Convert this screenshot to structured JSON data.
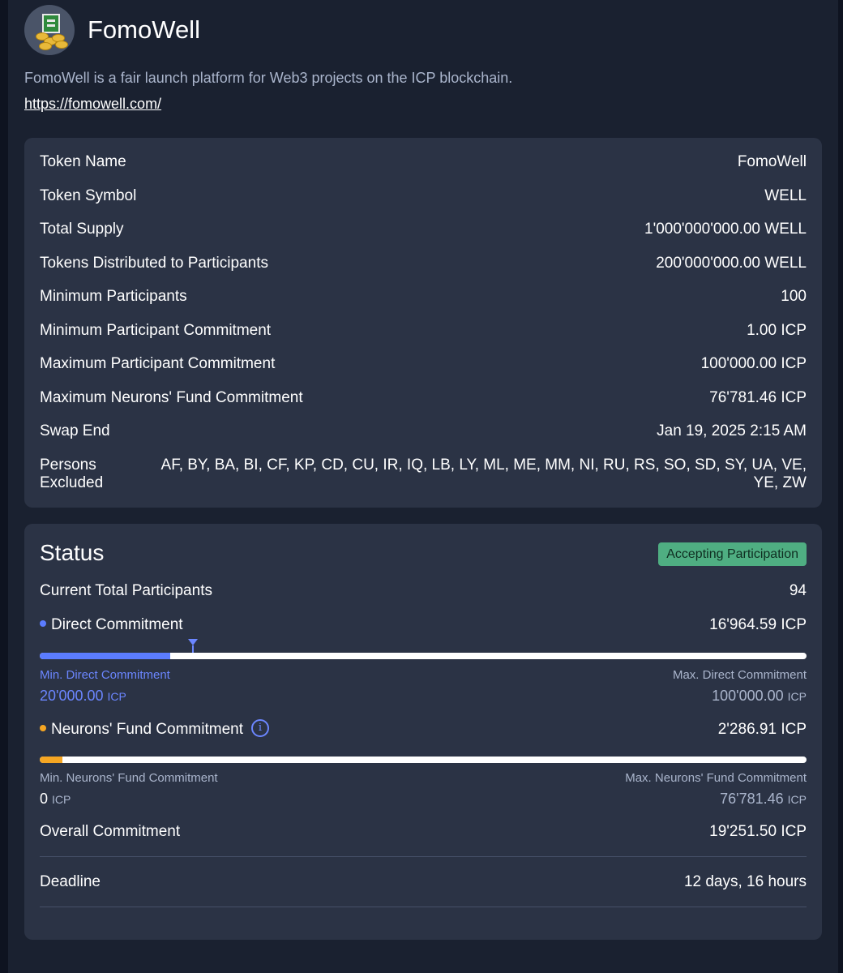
{
  "project": {
    "name": "FomoWell",
    "description": "FomoWell is a fair launch platform for Web3 projects on the ICP blockchain.",
    "url": "https://fomowell.com/",
    "logo_icon": "gold-coins-document-icon"
  },
  "details": [
    {
      "label": "Token Name",
      "value": "FomoWell"
    },
    {
      "label": "Token Symbol",
      "value": "WELL"
    },
    {
      "label": "Total Supply",
      "value": "1'000'000'000.00 WELL"
    },
    {
      "label": "Tokens Distributed to Participants",
      "value": "200'000'000.00 WELL"
    },
    {
      "label": "Minimum Participants",
      "value": "100"
    },
    {
      "label": "Minimum Participant Commitment",
      "value": "1.00 ICP"
    },
    {
      "label": "Maximum Participant Commitment",
      "value": "100'000.00 ICP"
    },
    {
      "label": "Maximum Neurons' Fund Commitment",
      "value": "76'781.46 ICP"
    },
    {
      "label": "Swap End",
      "value": "Jan 19, 2025 2:15 AM"
    },
    {
      "label": "Persons Excluded",
      "value": "AF, BY, BA, BI, CF, KP, CD, CU, IR, IQ, LB, LY, ML, ME, MM, NI, RU, RS, SO, SD, SY, UA, VE, YE, ZW"
    }
  ],
  "status": {
    "title": "Status",
    "badge": "Accepting Participation",
    "badge_color": "#4fae82",
    "participants": {
      "label": "Current Total Participants",
      "value": "94"
    },
    "direct": {
      "label": "Direct Commitment",
      "value": "16'964.59 ICP",
      "color": "#5b7cff",
      "progress": 0.17,
      "min_marker": 0.2,
      "min_label": "Min. Direct Commitment",
      "min_amount": "20'000.00",
      "max_label": "Max. Direct Commitment",
      "max_amount": "100'000.00",
      "unit": "ICP"
    },
    "neurons": {
      "label": "Neurons' Fund Commitment",
      "value": "2'286.91 ICP",
      "color": "#f5a623",
      "progress": 0.03,
      "min_label": "Min. Neurons' Fund Commitment",
      "min_amount": "0",
      "max_label": "Max. Neurons' Fund Commitment",
      "max_amount": "76'781.46",
      "unit": "ICP",
      "info_icon": "i"
    },
    "overall": {
      "label": "Overall Commitment",
      "value": "19'251.50 ICP"
    },
    "deadline": {
      "label": "Deadline",
      "value": "12 days, 16 hours"
    }
  }
}
